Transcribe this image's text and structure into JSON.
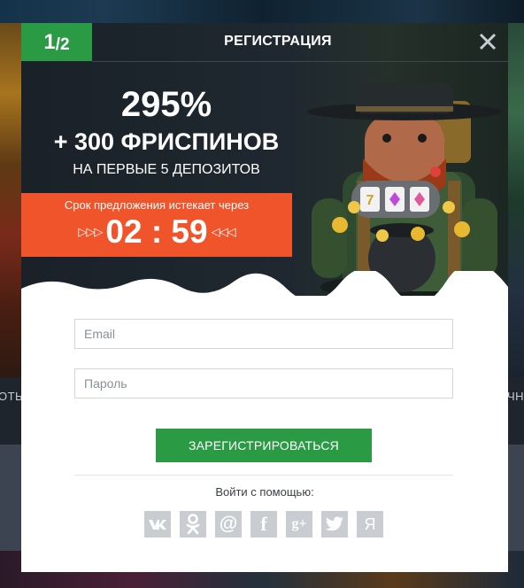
{
  "background": {
    "left_label": "ОТЫ",
    "right_label": "ЧН"
  },
  "modal": {
    "step_current": "1",
    "step_total": "/2",
    "title": "РЕГИСТРАЦИЯ",
    "close_icon": "close-icon"
  },
  "promo": {
    "percent": "295%",
    "free_spins": "+ 300 ФРИСПИНОВ",
    "deposits": "НА ПЕРВЫЕ 5 ДЕПОЗИТОВ",
    "offer_text": "Срок предложения истекает через",
    "arrows_left": "▷▷▷",
    "timer": "02 : 59",
    "arrows_right": "◁◁◁"
  },
  "form": {
    "email_placeholder": "Email",
    "password_placeholder": "Пароль",
    "register_label": "ЗАРЕГИСТРИРОВАТЬСЯ",
    "login_with": "Войти с помощью:"
  },
  "socials": [
    {
      "icon": "vk-icon",
      "glyph": "vk"
    },
    {
      "icon": "odnoklassniki-icon",
      "glyph": "ok"
    },
    {
      "icon": "mail-icon",
      "glyph": "@"
    },
    {
      "icon": "facebook-icon",
      "glyph": "f"
    },
    {
      "icon": "google-plus-icon",
      "glyph": "g+"
    },
    {
      "icon": "twitter-icon",
      "glyph": "tw"
    },
    {
      "icon": "yandex-icon",
      "glyph": "Я"
    }
  ],
  "colors": {
    "accent_green": "#2a9a45",
    "offer_orange": "#f0542b",
    "social_gray": "#c9cdd1"
  }
}
